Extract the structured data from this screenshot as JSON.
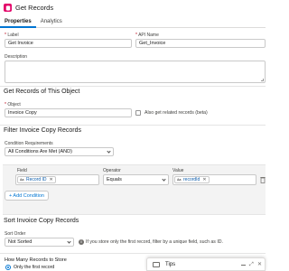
{
  "header": {
    "title": "Get Records",
    "icon": "database-icon"
  },
  "tabs": [
    {
      "label": "Properties"
    },
    {
      "label": "Analytics"
    }
  ],
  "fields": {
    "label": {
      "label": "Label",
      "value": "Get Invoice"
    },
    "api_name": {
      "label": "API Name",
      "value": "Get_Invoice"
    },
    "description": {
      "label": "Description",
      "value": ""
    }
  },
  "object_section": {
    "title": "Get Records of This Object",
    "object_label": "Object",
    "object_value": "Invoice Copy",
    "related_checkbox_label": "Also get related records (beta)",
    "related_checked": false
  },
  "filter_section": {
    "title": "Filter Invoice Copy Records",
    "requirements_label": "Condition Requirements",
    "requirements_value": "All Conditions Are Met (AND)",
    "field_header": "Field",
    "operator_header": "Operator",
    "value_header": "Value",
    "condition": {
      "field": "Record ID",
      "operator": "Equals",
      "value": "recordId"
    },
    "add_condition_label": "+ Add Condition"
  },
  "sort_section": {
    "title": "Sort Invoice Copy Records",
    "sort_order_label": "Sort Order",
    "sort_order_value": "Not Sorted",
    "info_text": "If you store only the first record, filter by a unique field, such as ID."
  },
  "store_section": {
    "title": "How Many Records to Store",
    "option_first": "Only the first record"
  },
  "tips": {
    "title": "Tips"
  }
}
